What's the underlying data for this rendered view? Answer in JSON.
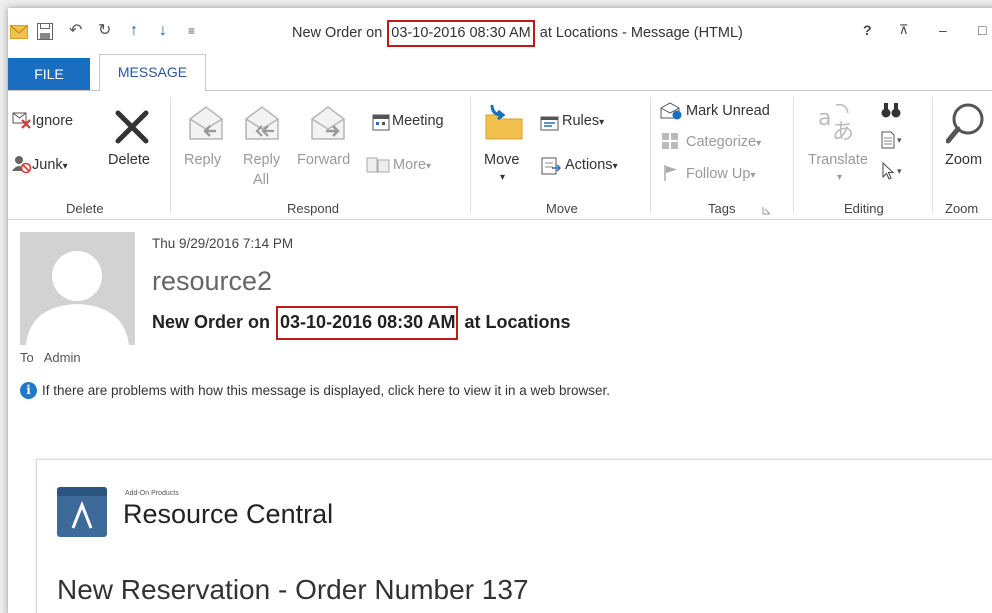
{
  "titlebar": {
    "icons": [
      "mail-icon",
      "save-icon",
      "undo-icon",
      "redo-icon",
      "up-arrow-icon",
      "down-arrow-icon",
      "customize-icon"
    ],
    "title_before": "New Order on ",
    "title_highlight": "03-10-2016 08:30 AM",
    "title_after": " at Locations - Message (HTML)",
    "help": "?",
    "restore": "⊼",
    "minimize": "–",
    "maximize": "□"
  },
  "tabs": {
    "file": "FILE",
    "message": "MESSAGE"
  },
  "ribbon": {
    "delete_group": {
      "ignore": "Ignore",
      "junk": "Junk",
      "delete": "Delete",
      "label": "Delete"
    },
    "respond_group": {
      "reply": "Reply",
      "reply_all_1": "Reply",
      "reply_all_2": "All",
      "forward": "Forward",
      "meeting": "Meeting",
      "more": "More",
      "label": "Respond"
    },
    "move_group": {
      "move": "Move",
      "rules": "Rules",
      "actions": "Actions",
      "label": "Move"
    },
    "tags_group": {
      "mark_unread": "Mark Unread",
      "categorize": "Categorize",
      "follow_up": "Follow Up",
      "label": "Tags"
    },
    "editing_group": {
      "translate": "Translate",
      "label": "Editing"
    },
    "zoom_group": {
      "zoom": "Zoom",
      "label": "Zoom"
    },
    "dropdown_caret": "▾"
  },
  "message": {
    "date": "Thu 9/29/2016 7:14 PM",
    "sender": "resource2",
    "subject_before": "New Order on ",
    "subject_highlight": "03-10-2016 08:30 AM",
    "subject_after": " at Locations",
    "to_label": "To",
    "to_value": "Admin",
    "info_text": "If there are problems with how this message is displayed, click here to view it in a web browser."
  },
  "body": {
    "brand_small": "Add-On Products",
    "brand_big": "Resource Central",
    "logo_glyph": "Λ",
    "heading": "New Reservation - Order Number 137"
  },
  "colors": {
    "accent_blue": "#1a6ec0",
    "highlight_red": "#c0191b",
    "tab_text": "#2b579a"
  }
}
